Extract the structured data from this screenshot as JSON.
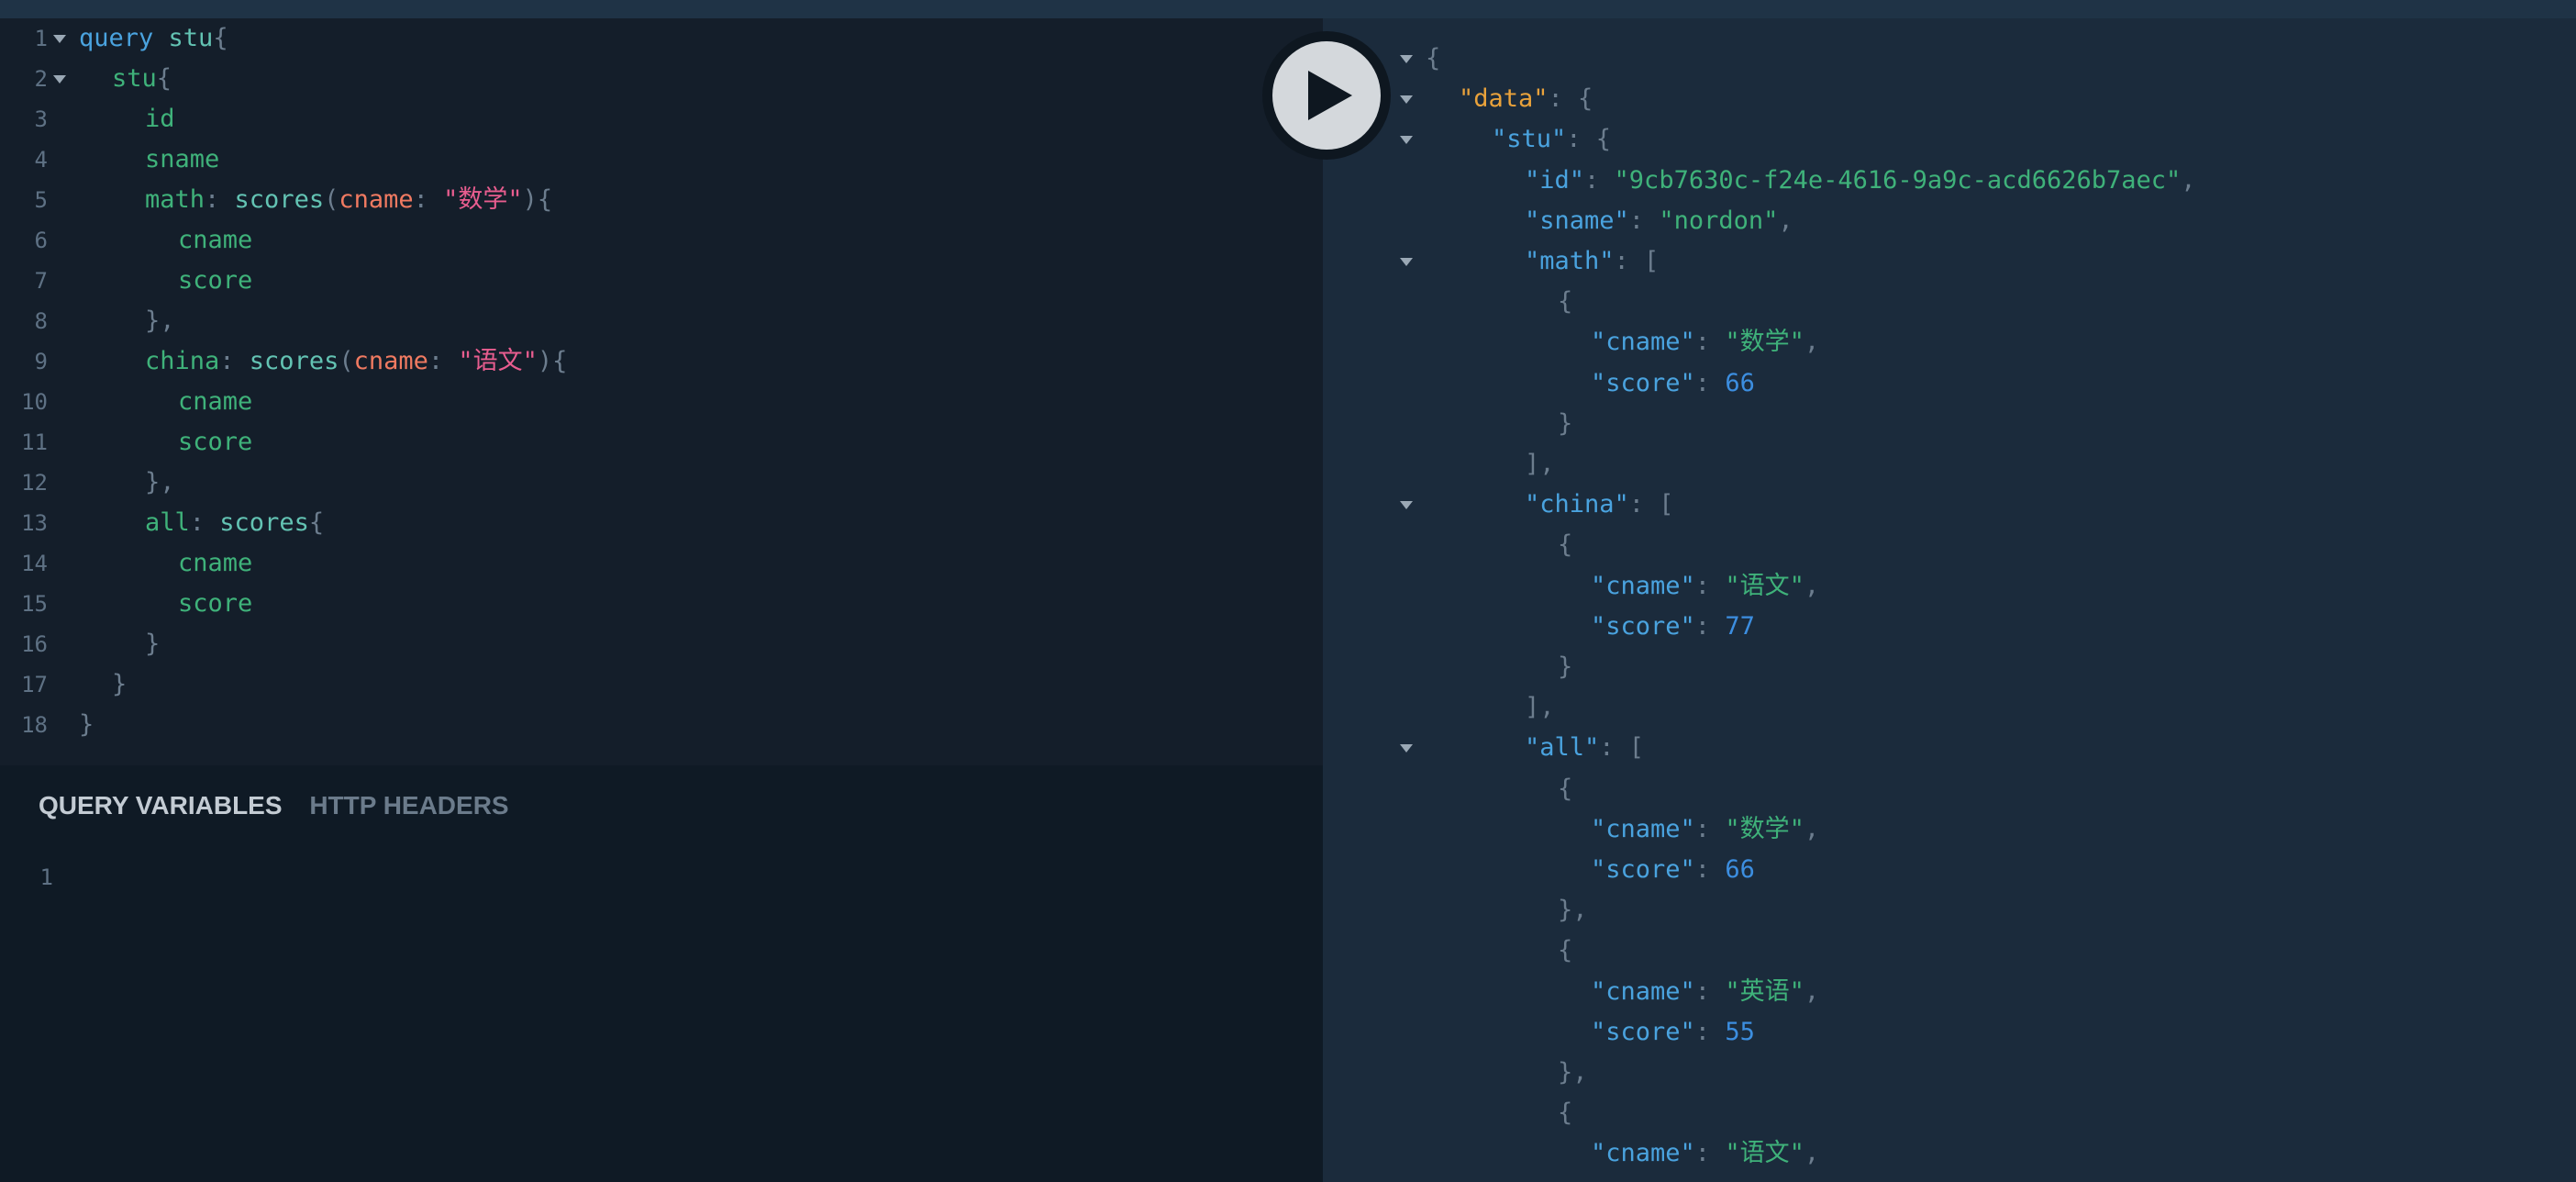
{
  "editor": {
    "lines": [
      {
        "n": "1",
        "fold": true,
        "indent": 0,
        "tokens": [
          {
            "t": "query",
            "c": "t-kw"
          },
          {
            "t": " ",
            "c": ""
          },
          {
            "t": "stu",
            "c": "t-def"
          },
          {
            "t": "{",
            "c": "t-punct"
          }
        ]
      },
      {
        "n": "2",
        "fold": true,
        "indent": 1,
        "tokens": [
          {
            "t": "stu",
            "c": "t-field"
          },
          {
            "t": "{",
            "c": "t-punct"
          }
        ]
      },
      {
        "n": "3",
        "fold": false,
        "indent": 2,
        "tokens": [
          {
            "t": "id",
            "c": "t-field"
          }
        ]
      },
      {
        "n": "4",
        "fold": false,
        "indent": 2,
        "tokens": [
          {
            "t": "sname",
            "c": "t-field"
          }
        ]
      },
      {
        "n": "5",
        "fold": false,
        "indent": 2,
        "tokens": [
          {
            "t": "math",
            "c": "t-field"
          },
          {
            "t": ": ",
            "c": "t-punct"
          },
          {
            "t": "scores",
            "c": "t-def"
          },
          {
            "t": "(",
            "c": "t-punct"
          },
          {
            "t": "cname",
            "c": "t-arg"
          },
          {
            "t": ": ",
            "c": "t-punct"
          },
          {
            "t": "\"数学\"",
            "c": "t-str"
          },
          {
            "t": "){",
            "c": "t-punct"
          }
        ]
      },
      {
        "n": "6",
        "fold": false,
        "indent": 3,
        "tokens": [
          {
            "t": "cname",
            "c": "t-field"
          }
        ]
      },
      {
        "n": "7",
        "fold": false,
        "indent": 3,
        "tokens": [
          {
            "t": "score",
            "c": "t-field"
          }
        ]
      },
      {
        "n": "8",
        "fold": false,
        "indent": 2,
        "tokens": [
          {
            "t": "},",
            "c": "t-punct"
          }
        ]
      },
      {
        "n": "9",
        "fold": false,
        "indent": 2,
        "tokens": [
          {
            "t": "china",
            "c": "t-field"
          },
          {
            "t": ": ",
            "c": "t-punct"
          },
          {
            "t": "scores",
            "c": "t-def"
          },
          {
            "t": "(",
            "c": "t-punct"
          },
          {
            "t": "cname",
            "c": "t-arg"
          },
          {
            "t": ": ",
            "c": "t-punct"
          },
          {
            "t": "\"语文\"",
            "c": "t-str"
          },
          {
            "t": "){",
            "c": "t-punct"
          }
        ]
      },
      {
        "n": "10",
        "fold": false,
        "indent": 3,
        "tokens": [
          {
            "t": "cname",
            "c": "t-field"
          }
        ]
      },
      {
        "n": "11",
        "fold": false,
        "indent": 3,
        "tokens": [
          {
            "t": "score",
            "c": "t-field"
          }
        ]
      },
      {
        "n": "12",
        "fold": false,
        "indent": 2,
        "tokens": [
          {
            "t": "},",
            "c": "t-punct"
          }
        ]
      },
      {
        "n": "13",
        "fold": false,
        "indent": 2,
        "tokens": [
          {
            "t": "all",
            "c": "t-field"
          },
          {
            "t": ": ",
            "c": "t-punct"
          },
          {
            "t": "scores",
            "c": "t-def"
          },
          {
            "t": "{",
            "c": "t-punct"
          }
        ]
      },
      {
        "n": "14",
        "fold": false,
        "indent": 3,
        "tokens": [
          {
            "t": "cname",
            "c": "t-field"
          }
        ]
      },
      {
        "n": "15",
        "fold": false,
        "indent": 3,
        "tokens": [
          {
            "t": "score",
            "c": "t-field"
          }
        ]
      },
      {
        "n": "16",
        "fold": false,
        "indent": 2,
        "tokens": [
          {
            "t": "}",
            "c": "t-punct"
          }
        ]
      },
      {
        "n": "17",
        "fold": false,
        "indent": 1,
        "tokens": [
          {
            "t": "}",
            "c": "t-punct"
          }
        ]
      },
      {
        "n": "18",
        "fold": false,
        "indent": 0,
        "tokens": [
          {
            "t": "}",
            "c": "t-punct"
          }
        ]
      }
    ]
  },
  "variables_pane": {
    "tabs": [
      {
        "label": "QUERY VARIABLES",
        "active": true
      },
      {
        "label": "HTTP HEADERS",
        "active": false
      }
    ],
    "lines": [
      {
        "n": "1"
      }
    ]
  },
  "run_button": {
    "icon": "play-icon"
  },
  "result": {
    "lines": [
      {
        "fold": true,
        "indent": 0,
        "tokens": [
          {
            "t": "{",
            "c": "t-punct"
          }
        ]
      },
      {
        "fold": true,
        "indent": 1,
        "tokens": [
          {
            "t": "\"data\"",
            "c": "t-dkey"
          },
          {
            "t": ": {",
            "c": "t-punct"
          }
        ]
      },
      {
        "fold": true,
        "indent": 2,
        "tokens": [
          {
            "t": "\"stu\"",
            "c": "t-key"
          },
          {
            "t": ": {",
            "c": "t-punct"
          }
        ]
      },
      {
        "fold": false,
        "indent": 3,
        "tokens": [
          {
            "t": "\"id\"",
            "c": "t-key"
          },
          {
            "t": ": ",
            "c": "t-punct"
          },
          {
            "t": "\"9cb7630c-f24e-4616-9a9c-acd6626b7aec\"",
            "c": "t-jstr"
          },
          {
            "t": ",",
            "c": "t-punct"
          }
        ]
      },
      {
        "fold": false,
        "indent": 3,
        "tokens": [
          {
            "t": "\"sname\"",
            "c": "t-key"
          },
          {
            "t": ": ",
            "c": "t-punct"
          },
          {
            "t": "\"nordon\"",
            "c": "t-jstr"
          },
          {
            "t": ",",
            "c": "t-punct"
          }
        ]
      },
      {
        "fold": true,
        "indent": 3,
        "tokens": [
          {
            "t": "\"math\"",
            "c": "t-key"
          },
          {
            "t": ": [",
            "c": "t-punct"
          }
        ]
      },
      {
        "fold": false,
        "indent": 4,
        "tokens": [
          {
            "t": "{",
            "c": "t-punct"
          }
        ]
      },
      {
        "fold": false,
        "indent": 5,
        "tokens": [
          {
            "t": "\"cname\"",
            "c": "t-key"
          },
          {
            "t": ": ",
            "c": "t-punct"
          },
          {
            "t": "\"数学\"",
            "c": "t-jstr"
          },
          {
            "t": ",",
            "c": "t-punct"
          }
        ]
      },
      {
        "fold": false,
        "indent": 5,
        "tokens": [
          {
            "t": "\"score\"",
            "c": "t-key"
          },
          {
            "t": ": ",
            "c": "t-punct"
          },
          {
            "t": "66",
            "c": "t-num"
          }
        ]
      },
      {
        "fold": false,
        "indent": 4,
        "tokens": [
          {
            "t": "}",
            "c": "t-punct"
          }
        ]
      },
      {
        "fold": false,
        "indent": 3,
        "tokens": [
          {
            "t": "],",
            "c": "t-punct"
          }
        ]
      },
      {
        "fold": true,
        "indent": 3,
        "tokens": [
          {
            "t": "\"china\"",
            "c": "t-key"
          },
          {
            "t": ": [",
            "c": "t-punct"
          }
        ]
      },
      {
        "fold": false,
        "indent": 4,
        "tokens": [
          {
            "t": "{",
            "c": "t-punct"
          }
        ]
      },
      {
        "fold": false,
        "indent": 5,
        "tokens": [
          {
            "t": "\"cname\"",
            "c": "t-key"
          },
          {
            "t": ": ",
            "c": "t-punct"
          },
          {
            "t": "\"语文\"",
            "c": "t-jstr"
          },
          {
            "t": ",",
            "c": "t-punct"
          }
        ]
      },
      {
        "fold": false,
        "indent": 5,
        "tokens": [
          {
            "t": "\"score\"",
            "c": "t-key"
          },
          {
            "t": ": ",
            "c": "t-punct"
          },
          {
            "t": "77",
            "c": "t-num"
          }
        ]
      },
      {
        "fold": false,
        "indent": 4,
        "tokens": [
          {
            "t": "}",
            "c": "t-punct"
          }
        ]
      },
      {
        "fold": false,
        "indent": 3,
        "tokens": [
          {
            "t": "],",
            "c": "t-punct"
          }
        ]
      },
      {
        "fold": true,
        "indent": 3,
        "tokens": [
          {
            "t": "\"all\"",
            "c": "t-key"
          },
          {
            "t": ": [",
            "c": "t-punct"
          }
        ]
      },
      {
        "fold": false,
        "indent": 4,
        "tokens": [
          {
            "t": "{",
            "c": "t-punct"
          }
        ]
      },
      {
        "fold": false,
        "indent": 5,
        "tokens": [
          {
            "t": "\"cname\"",
            "c": "t-key"
          },
          {
            "t": ": ",
            "c": "t-punct"
          },
          {
            "t": "\"数学\"",
            "c": "t-jstr"
          },
          {
            "t": ",",
            "c": "t-punct"
          }
        ]
      },
      {
        "fold": false,
        "indent": 5,
        "tokens": [
          {
            "t": "\"score\"",
            "c": "t-key"
          },
          {
            "t": ": ",
            "c": "t-punct"
          },
          {
            "t": "66",
            "c": "t-num"
          }
        ]
      },
      {
        "fold": false,
        "indent": 4,
        "tokens": [
          {
            "t": "},",
            "c": "t-punct"
          }
        ]
      },
      {
        "fold": false,
        "indent": 4,
        "tokens": [
          {
            "t": "{",
            "c": "t-punct"
          }
        ]
      },
      {
        "fold": false,
        "indent": 5,
        "tokens": [
          {
            "t": "\"cname\"",
            "c": "t-key"
          },
          {
            "t": ": ",
            "c": "t-punct"
          },
          {
            "t": "\"英语\"",
            "c": "t-jstr"
          },
          {
            "t": ",",
            "c": "t-punct"
          }
        ]
      },
      {
        "fold": false,
        "indent": 5,
        "tokens": [
          {
            "t": "\"score\"",
            "c": "t-key"
          },
          {
            "t": ": ",
            "c": "t-punct"
          },
          {
            "t": "55",
            "c": "t-num"
          }
        ]
      },
      {
        "fold": false,
        "indent": 4,
        "tokens": [
          {
            "t": "},",
            "c": "t-punct"
          }
        ]
      },
      {
        "fold": false,
        "indent": 4,
        "tokens": [
          {
            "t": "{",
            "c": "t-punct"
          }
        ]
      },
      {
        "fold": false,
        "indent": 5,
        "tokens": [
          {
            "t": "\"cname\"",
            "c": "t-key"
          },
          {
            "t": ": ",
            "c": "t-punct"
          },
          {
            "t": "\"语文\"",
            "c": "t-jstr"
          },
          {
            "t": ",",
            "c": "t-punct"
          }
        ]
      }
    ]
  }
}
